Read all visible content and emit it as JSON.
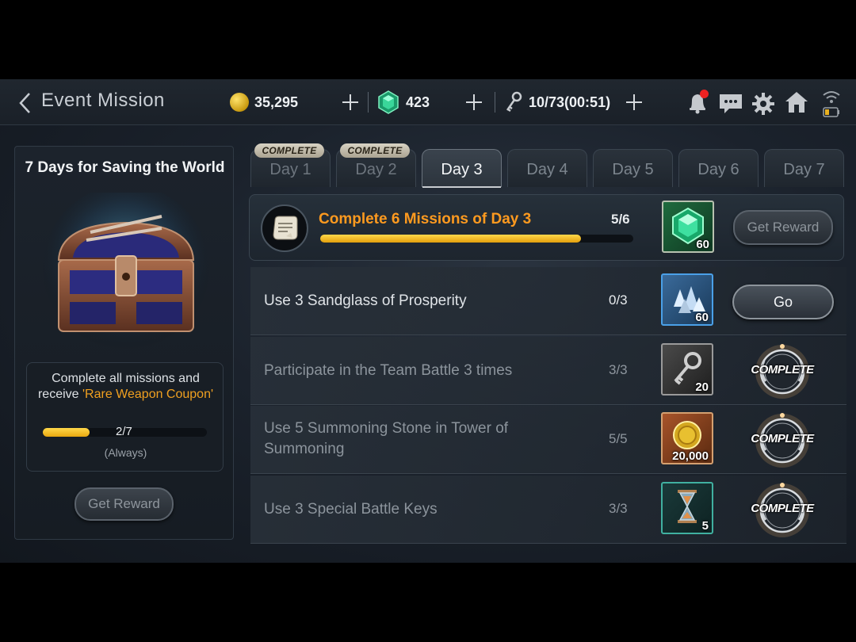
{
  "header": {
    "title": "Event Mission",
    "gold": "35,295",
    "gems": "423",
    "stamina": "10/73(00:51)"
  },
  "left_panel": {
    "title": "7 Days for Saving the World",
    "desc_line1": "Complete all missions and",
    "desc_line2_prefix": "receive ",
    "desc_highlight": "'Rare Weapon Coupon'",
    "progress_text": "2/7",
    "progress_fraction": 0.2857,
    "note": "(Always)",
    "button_label": "Get Reward"
  },
  "tabs": [
    {
      "label": "Day 1",
      "badge": "COMPLETE",
      "state": "done"
    },
    {
      "label": "Day 2",
      "badge": "COMPLETE",
      "state": "done"
    },
    {
      "label": "Day 3",
      "badge": "",
      "state": "active"
    },
    {
      "label": "Day 4",
      "badge": "",
      "state": "normal"
    },
    {
      "label": "Day 5",
      "badge": "",
      "state": "normal"
    },
    {
      "label": "Day 6",
      "badge": "",
      "state": "normal"
    },
    {
      "label": "Day 7",
      "badge": "",
      "state": "normal"
    }
  ],
  "main_mission": {
    "title": "Complete 6 Missions of Day 3",
    "progress_text": "5/6",
    "progress_fraction": 0.8333,
    "reward_icon": "green-gem-icon",
    "reward_qty": "60",
    "button_label": "Get Reward"
  },
  "missions": [
    {
      "title": "Use 3 Sandglass of Prosperity",
      "progress": "0/3",
      "reward_icon": "crystal-shards-icon",
      "reward_qty": "60",
      "action": "Go",
      "completed": false
    },
    {
      "title": "Participate in the Team Battle 3 times",
      "progress": "3/3",
      "reward_icon": "key-icon",
      "reward_qty": "20",
      "action": "COMPLETE",
      "completed": true
    },
    {
      "title": "Use 5 Summoning Stone in Tower of Summoning",
      "progress": "5/5",
      "reward_icon": "gold-coin-icon",
      "reward_qty": "20,000",
      "action": "COMPLETE",
      "completed": true
    },
    {
      "title": "Use 3 Special Battle Keys",
      "progress": "3/3",
      "reward_icon": "hourglass-icon",
      "reward_qty": "5",
      "action": "COMPLETE",
      "completed": true
    }
  ],
  "colors": {
    "accent_orange": "#ff9a1f",
    "progress_yellow": "#f0c020",
    "notification_red": "#ee2222"
  }
}
